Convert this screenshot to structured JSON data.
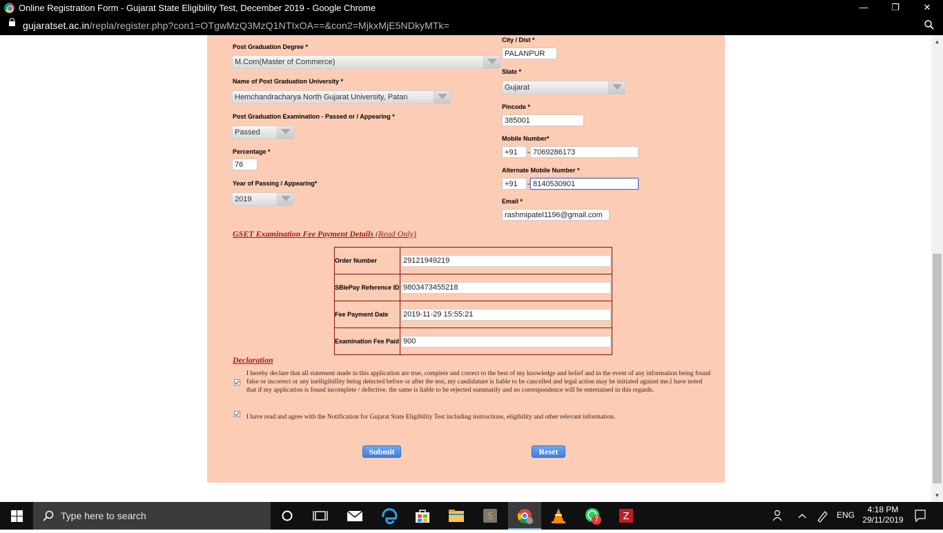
{
  "window": {
    "title": "Online Registration Form - Gujarat State Eligibility Test, December 2019 - Google Chrome",
    "minimize": "—",
    "maximize": "❐",
    "close": "✕"
  },
  "address_bar": {
    "host": "gujaratset.ac.in",
    "path": "/repla/register.php?con1=OTgwMzQ3MzQ1NTIxOA==&con2=MjkxMjE5NDkyMTk="
  },
  "form": {
    "pg_degree": {
      "label": "Post Graduation Degree *",
      "value": "M.Com(Master of Commerce)"
    },
    "pg_university": {
      "label": "Name of Post Graduation University *",
      "value": "Hemchandracharya North Gujarat University, Patan"
    },
    "pg_exam_status": {
      "label": "Post Graduation Examination - Passed or / Appearing *",
      "value": "Passed"
    },
    "percentage": {
      "label": "Percentage *",
      "value": "76"
    },
    "year_of_passing": {
      "label": "Year of Passing / Appearing*",
      "value": "2019"
    },
    "city": {
      "label": "City / Dist *",
      "value": "PALANPUR"
    },
    "state": {
      "label": "State *",
      "value": "Gujarat"
    },
    "pincode": {
      "label": "Pincode *",
      "value": "385001"
    },
    "mobile": {
      "label": "Mobile Number*",
      "code": "+91",
      "sep": "-",
      "value": "7069286173"
    },
    "alt_mobile": {
      "label": "Alternate Mobile Number *",
      "code": "+91",
      "sep": "-",
      "value": "8140530901"
    },
    "email": {
      "label": "Email *",
      "value": "rashmipatel1196@gmail.com"
    }
  },
  "fee_section": {
    "title": "GSET Examination Fee Payment Details",
    "readonly_note": "(Read Only)",
    "rows": [
      {
        "label": "Order Number",
        "value": "29121949219"
      },
      {
        "label": "SBIePay Reference ID",
        "value": "9803473455218"
      },
      {
        "label": "Fee Payment Date",
        "value": "2019-11-29 15:55:21"
      },
      {
        "label": "Examination Fee Paid",
        "value": "900"
      }
    ]
  },
  "declaration": {
    "title": "Declaration",
    "text1": "I hereby declare that all statement made in this application are true, complete and correct to the best of my knowledge and belief and in the event of any information being found false or incorrect or any inelligibillity being detected before or after the test, my candidature is liable to be cancelled and legal action may be initiated against me.I have noted that if my application is found incomplete / defective, the same is liable to be rejected summarily and no correspondence will be entertained in this regards.",
    "text2": "I have read and agree with the Notification for Gujarat State Eligibility Test including instructions, eligibility and other relevant information."
  },
  "buttons": {
    "submit": "Submit",
    "reset": "Reset"
  },
  "taskbar": {
    "search_placeholder": "Type here to search",
    "language": "ENG",
    "time": "4:18 PM",
    "date": "29/11/2019",
    "whatsapp_badge": "7"
  },
  "colors": {
    "panel_bg": "#fdccb4",
    "section_title": "#a21a1a",
    "button": "#4a8ae6"
  }
}
